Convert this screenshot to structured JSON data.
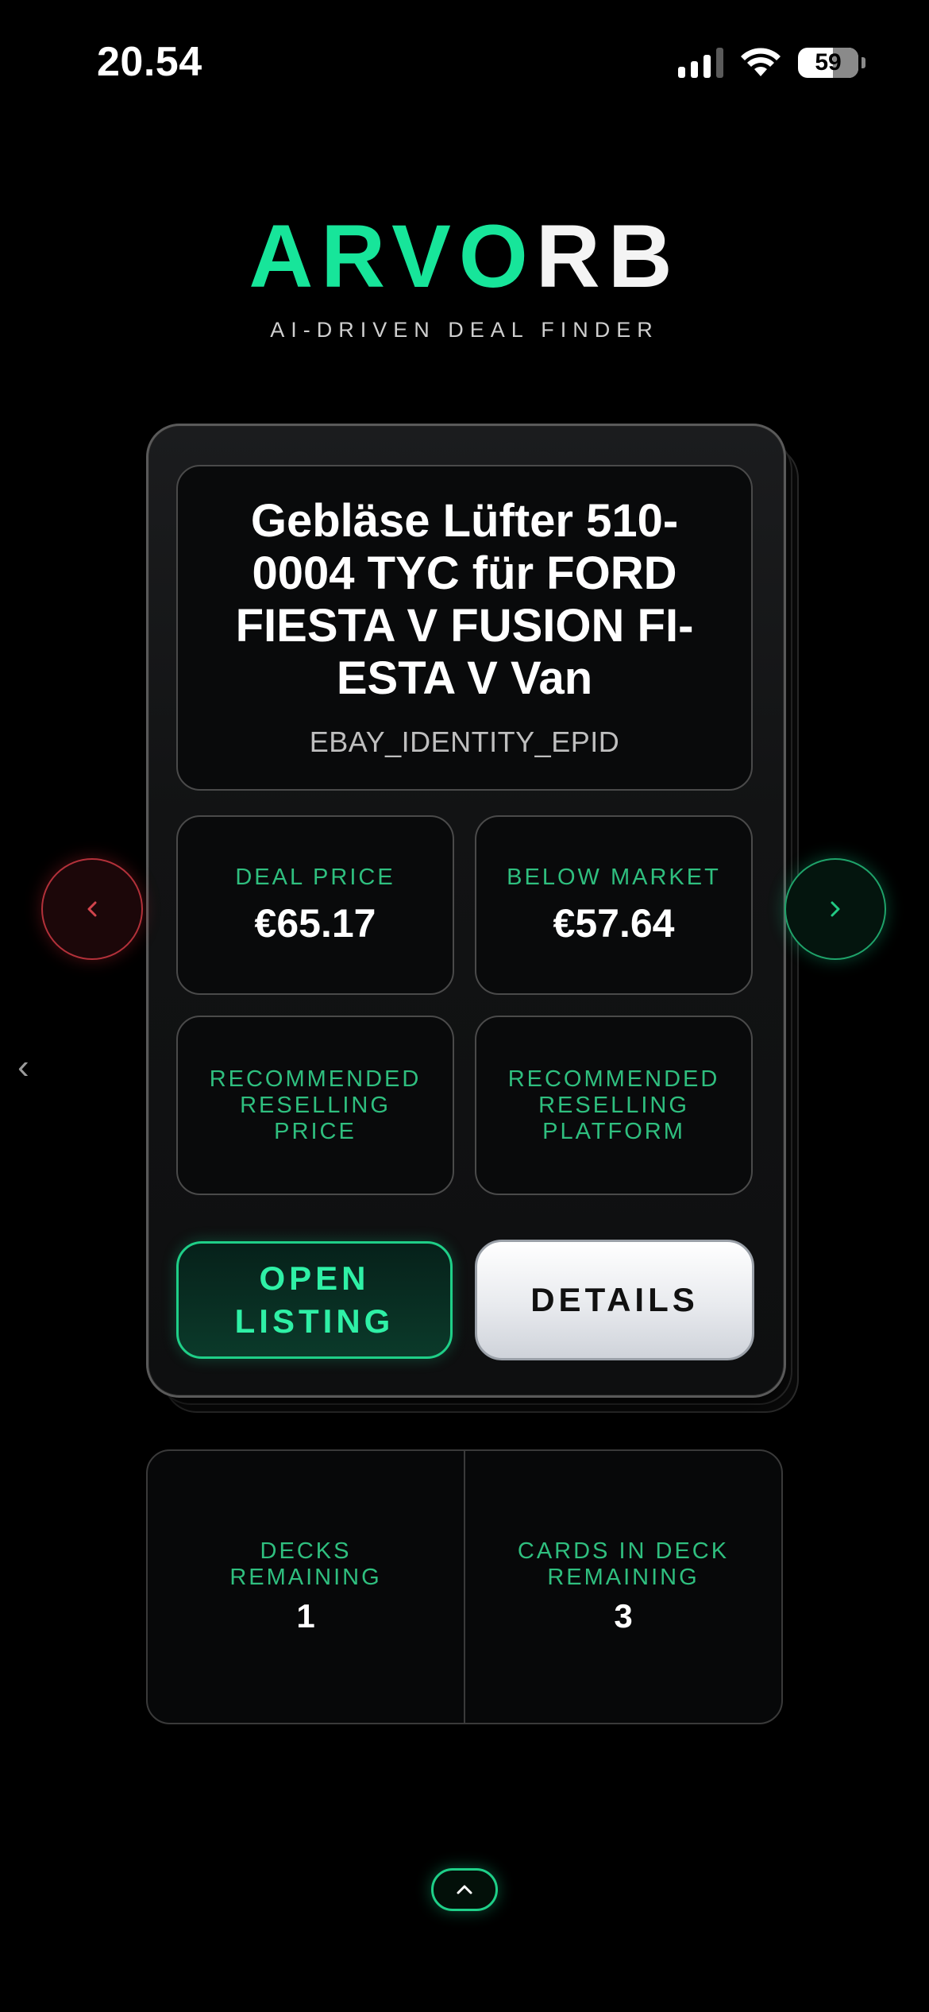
{
  "status_bar": {
    "time": "20.54",
    "battery_level": "59",
    "signal_bars": 4,
    "signal_bars_active": 3
  },
  "brand": {
    "logo_part_green": "ARVO",
    "logo_part_white": "RB",
    "tagline": "AI-DRIVEN DEAL FINDER",
    "accent_color": "#17e59a"
  },
  "card": {
    "title": "Gebläse Lüfter 510-0004 TYC für FORD FIESTA V FUSION FI-ESTA V Van",
    "subtitle": "EBAY_IDENTITY_EPID",
    "stats": [
      {
        "label": "DEAL PRICE",
        "value": "€65.17"
      },
      {
        "label": "BELOW MARKET",
        "value": "€57.64"
      },
      {
        "label": "RECOMMENDED RESELLING PRICE",
        "value": ""
      },
      {
        "label": "RECOMMENDED RESELLING PLATFORM",
        "value": ""
      }
    ],
    "buttons": {
      "open_listing": "OPEN LISTING",
      "details": "DETAILS"
    }
  },
  "navigation": {
    "prev_icon": "chevron-left-icon",
    "next_icon": "chevron-right-icon",
    "edge_back": "‹",
    "scroll_up_icon": "chevron-up-icon"
  },
  "deck": {
    "decks_remaining_label": "DECKS REMAINING",
    "decks_remaining": "1",
    "cards_remaining_label": "CARDS IN DECK REMAINING",
    "cards_remaining": "3"
  }
}
